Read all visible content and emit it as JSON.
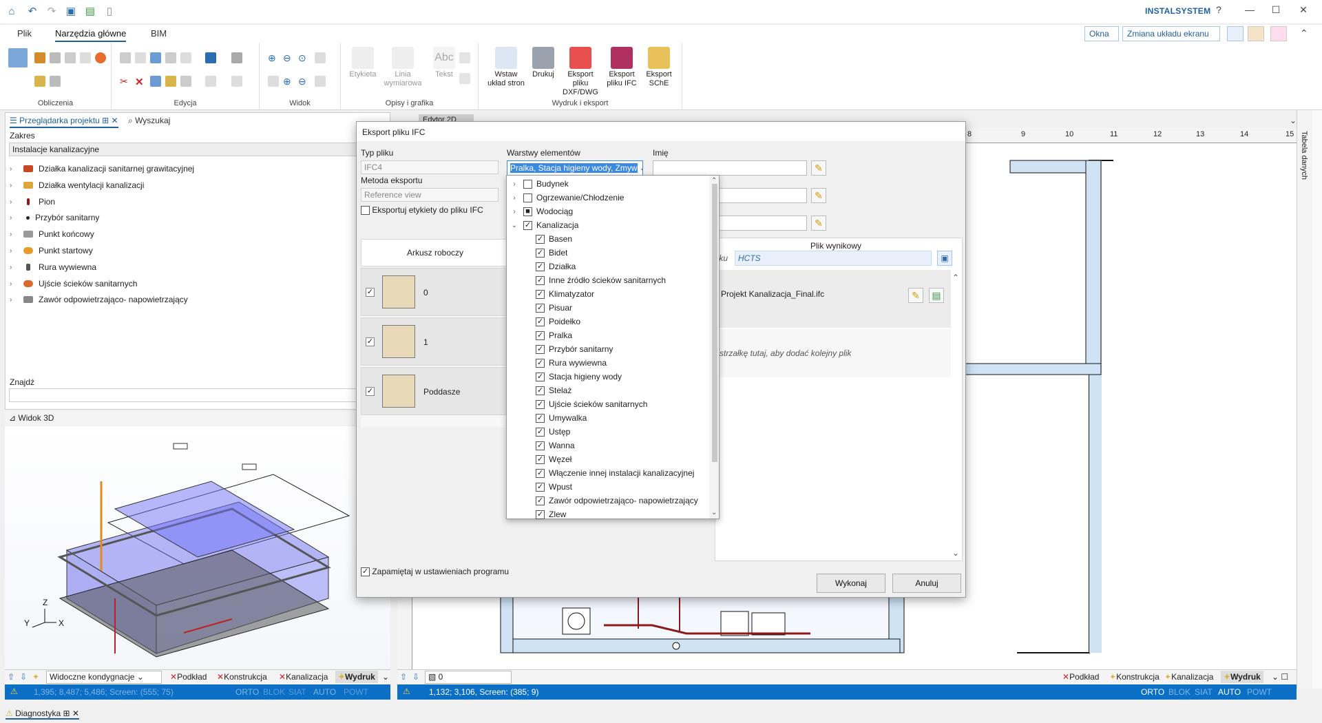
{
  "app": {
    "brand": "INSTALSYSTEM"
  },
  "ribbon_tabs": [
    "Plik",
    "Narzędzia główne",
    "BIM"
  ],
  "top_right": {
    "windows": "Okna",
    "layout": "Zmiana układu ekranu"
  },
  "ribbon_groups": {
    "obliczenia": "Obliczenia",
    "edycja": "Edycja",
    "widok": "Widok",
    "opisy": "Opisy i grafika",
    "wydruk": "Wydruk i eksport"
  },
  "ribbon_buttons": {
    "etykieta": "Etykieta",
    "linia": "Linia wymiarowa",
    "tekst": "Tekst",
    "wstaw": "Wstaw układ stron",
    "drukuj": "Drukuj",
    "dxf": "Eksport pliku DXF/DWG",
    "ifc": "Eksport pliku IFC",
    "sche": "Eksport SChE"
  },
  "left_panel": {
    "tab_browser": "Przeglądarka projektu",
    "tab_search": "Wyszukaj",
    "scope_label": "Zakres",
    "scope_value": "Instalacje kanalizacyjne",
    "items": [
      "Działka kanalizacji sanitarnej grawitacyjnej",
      "Działka wentylacji kanalizacji",
      "Pion",
      "Przybór sanitarny",
      "Punkt końcowy",
      "Punkt startowy",
      "Rura wywiewna",
      "Ujście ścieków sanitarnych",
      "Zawór odpowietrzająco- napowietrzający"
    ],
    "find_label": "Znajdź",
    "view3d_title": "Widok 3D"
  },
  "bottom_left": {
    "visible": "Widoczne kondygnacje",
    "tabs": [
      "Podkład",
      "Konstrukcja",
      "Kanalizacja",
      "Wydruk"
    ],
    "status": "1,395; 8,487; 5,486; Screen: (555; 75)",
    "modes": [
      "ORTO",
      "BLOK",
      "SIAT",
      "AUTO",
      "POWT"
    ]
  },
  "bottom_right": {
    "level": "0",
    "tabs": [
      "Podkład",
      "Konstrukcja",
      "Kanalizacja",
      "Wydruk"
    ],
    "status": "1,132; 3,106, Screen: (385; 9)",
    "modes": [
      "ORTO",
      "BLOK",
      "SIAT",
      "AUTO",
      "POWT"
    ]
  },
  "diagnostics": "Diagnostyka",
  "side_tab": "Tabela danych",
  "ruler": [
    "8",
    "9",
    "10",
    "11",
    "12",
    "13",
    "14",
    "15"
  ],
  "editor_tab": "Edytor 2D",
  "dialog": {
    "title": "Eksport pliku IFC",
    "file_type_label": "Typ pliku",
    "file_type_value": "IFC4",
    "method_label": "Metoda eksportu",
    "method_value": "Reference view",
    "export_labels": "Eksportuj etykiety do pliku IFC",
    "layers_label": "Warstwy elementów",
    "layers_value": "Pralka, Stacja higieny wody, Zmyw",
    "name_label": "Imię",
    "sheet_header": "Arkusz roboczy",
    "sheets": [
      "0",
      "1",
      "Poddasze"
    ],
    "output_header": "Plik wynikowy",
    "output_prefix": "liku",
    "output_value": "HCTS",
    "output_file": "Projekt Kanalizacja_Final.ifc",
    "add_hint": "j strzałkę tutaj, aby dodać kolejny plik",
    "remember": "Zapamiętaj w ustawieniach programu",
    "ok": "Wykonaj",
    "cancel": "Anuluj"
  },
  "layers_tree": [
    {
      "label": "Budynek",
      "level": 0,
      "expand": "›",
      "check": ""
    },
    {
      "label": "Ogrzewanie/Chłodzenie",
      "level": 0,
      "expand": "›",
      "check": ""
    },
    {
      "label": "Wodociąg",
      "level": 0,
      "expand": "›",
      "check": "■"
    },
    {
      "label": "Kanalizacja",
      "level": 0,
      "expand": "⌄",
      "check": "✓"
    },
    {
      "label": "Basen",
      "level": 1,
      "expand": "",
      "check": "✓"
    },
    {
      "label": "Bidet",
      "level": 1,
      "expand": "",
      "check": "✓"
    },
    {
      "label": "Działka",
      "level": 1,
      "expand": "",
      "check": "✓"
    },
    {
      "label": "Inne źródło ścieków sanitarnych",
      "level": 1,
      "expand": "",
      "check": "✓"
    },
    {
      "label": "Klimatyzator",
      "level": 1,
      "expand": "",
      "check": "✓"
    },
    {
      "label": "Pisuar",
      "level": 1,
      "expand": "",
      "check": "✓"
    },
    {
      "label": "Poidełko",
      "level": 1,
      "expand": "",
      "check": "✓"
    },
    {
      "label": "Pralka",
      "level": 1,
      "expand": "",
      "check": "✓"
    },
    {
      "label": "Przybór sanitarny",
      "level": 1,
      "expand": "",
      "check": "✓"
    },
    {
      "label": "Rura wywiewna",
      "level": 1,
      "expand": "",
      "check": "✓"
    },
    {
      "label": "Stacja higieny wody",
      "level": 1,
      "expand": "",
      "check": "✓"
    },
    {
      "label": "Stelaż",
      "level": 1,
      "expand": "",
      "check": "✓"
    },
    {
      "label": "Ujście ścieków sanitarnych",
      "level": 1,
      "expand": "",
      "check": "✓"
    },
    {
      "label": "Umywalka",
      "level": 1,
      "expand": "",
      "check": "✓"
    },
    {
      "label": "Ustęp",
      "level": 1,
      "expand": "",
      "check": "✓"
    },
    {
      "label": "Wanna",
      "level": 1,
      "expand": "",
      "check": "✓"
    },
    {
      "label": "Węzeł",
      "level": 1,
      "expand": "",
      "check": "✓"
    },
    {
      "label": "Włączenie innej instalacji kanalizacyjnej",
      "level": 1,
      "expand": "",
      "check": "✓"
    },
    {
      "label": "Wpust",
      "level": 1,
      "expand": "",
      "check": "✓"
    },
    {
      "label": "Zawór odpowietrzająco- napowietrzający",
      "level": 1,
      "expand": "",
      "check": "✓"
    },
    {
      "label": "Zlew",
      "level": 1,
      "expand": "",
      "check": "✓"
    }
  ],
  "colors": {
    "accent": "#1f5f9e",
    "status": "#0a6fc5",
    "wall": "#cfe3f5",
    "pipe": "#8b1a1a"
  }
}
